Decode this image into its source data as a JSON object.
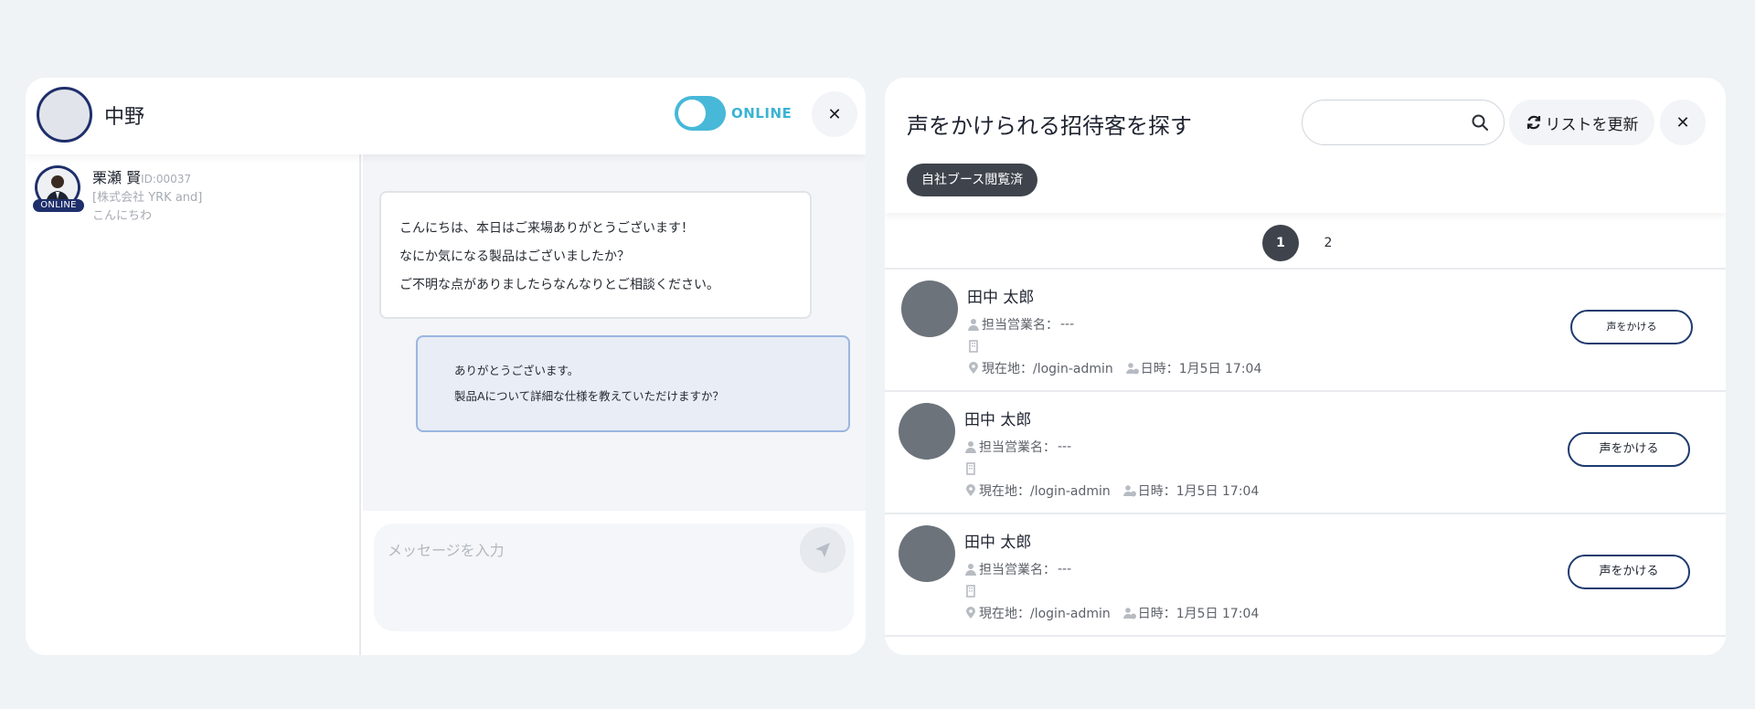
{
  "chat": {
    "host_name": "中野",
    "status_label": "ONLINE",
    "close_symbol": "✕",
    "contact": {
      "name": "栗瀬 賢",
      "id_text": "ID:00037",
      "badge": "ONLINE",
      "company": "[株式会社 YRK and]",
      "last_message": "こんにちわ"
    },
    "messages": [
      {
        "direction": "incoming",
        "lines": [
          "こんにちは、本日はご来場ありがとうございます！",
          "なにか気になる製品はございましたか？",
          "ご不明な点がありましたらなんなりとご相談ください。"
        ]
      },
      {
        "direction": "outgoing",
        "lines": [
          "ありがとうございます。",
          "製品Aについて詳細な仕様を教えていただけますか？"
        ]
      }
    ],
    "composer": {
      "placeholder": "メッセージを入力",
      "send_icon": "send-icon"
    }
  },
  "search": {
    "title": "声をかけられる招待客を探す",
    "search_value": "",
    "refresh_label": "リストを更新",
    "close_symbol": "✕",
    "filter_chip": "自社ブース閲覧済",
    "pages": [
      "1",
      "2"
    ],
    "current_page": "1",
    "guests": [
      {
        "name": "田中 太郎",
        "sales_label": "担当営業名：",
        "sales_value": "---",
        "location": "現在地：/login-admin",
        "datetime": "日時：1月5日 17:04",
        "button": "声をかける"
      },
      {
        "name": "田中 太郎",
        "sales_label": "担当営業名：",
        "sales_value": "---",
        "location": "現在地：/login-admin",
        "datetime": "日時：1月5日 17:04",
        "button": "声をかける"
      },
      {
        "name": "田中 太郎",
        "sales_label": "担当営業名：",
        "sales_value": "---",
        "location": "現在地：/login-admin",
        "datetime": "日時：1月5日 17:04",
        "button": "声をかける"
      }
    ]
  },
  "colors": {
    "background": "#eff3f6",
    "accent_navy": "#1f2f6b",
    "online_cyan": "#3ab3d3",
    "chip_dark": "#3f444c",
    "outgoing_bubble": "#e8edf6"
  }
}
